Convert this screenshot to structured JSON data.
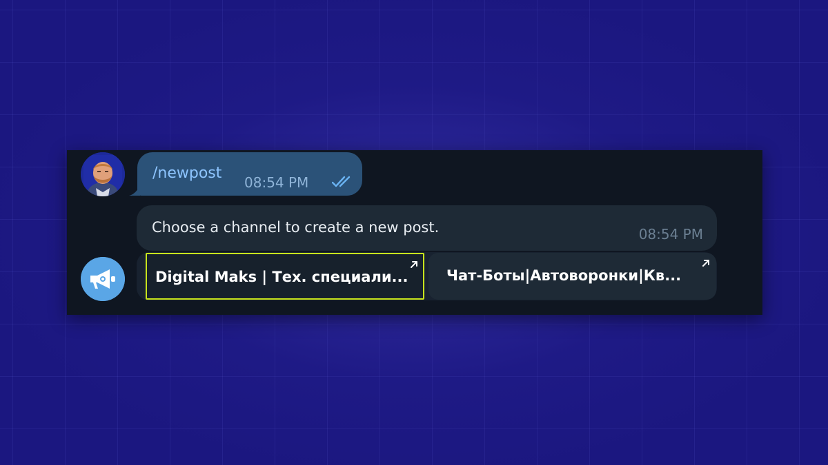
{
  "chat": {
    "user_message": {
      "text": "/newpost",
      "time": "08:54 PM",
      "status_icon": "double-check-icon"
    },
    "bot_message": {
      "text": "Choose a channel to create a new post.",
      "time": "08:54 PM"
    },
    "inline_keyboard": [
      {
        "label": "Digital Maks | Тех. специали...",
        "icon": "external-link-arrow-icon"
      },
      {
        "label": "Чат-Боты|Автоворонки|Кв...",
        "icon": "external-link-arrow-icon"
      }
    ]
  },
  "colors": {
    "background": "#1b1780",
    "panel": "#0f1621",
    "outgoing_bubble": "#2b5278",
    "incoming_bubble": "#1e2a36",
    "command_text": "#8ec5ff",
    "focus_outline": "#c8e41c",
    "bot_avatar": "#5aa6e6"
  }
}
